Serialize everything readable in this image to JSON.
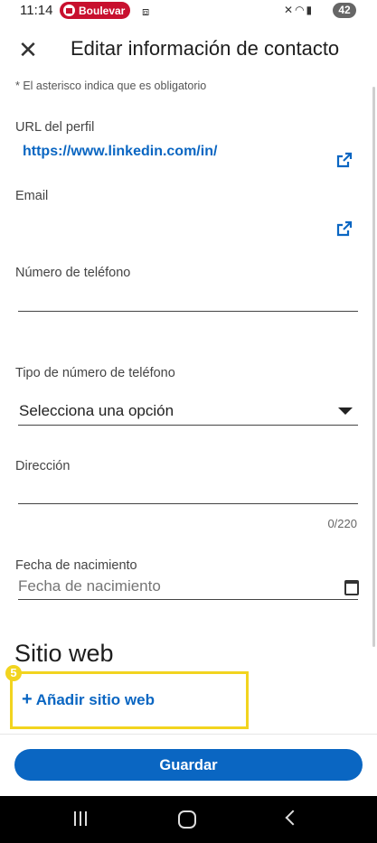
{
  "status_bar": {
    "time": "11:14",
    "media_label": "Boulevar",
    "battery": "42"
  },
  "header": {
    "title": "Editar información de contacto"
  },
  "form": {
    "required_hint": "* El asterisco indica que es obligatorio",
    "profile_url": {
      "label": "URL del perfil",
      "value": "https://www.linkedin.com/in/"
    },
    "email": {
      "label": "Email"
    },
    "phone": {
      "label": "Número de teléfono",
      "value": ""
    },
    "phone_type": {
      "label": "Tipo de número de teléfono",
      "selected": "Selecciona una opción"
    },
    "address": {
      "label": "Dirección",
      "value": "",
      "counter": "0/220"
    },
    "birthday": {
      "label": "Fecha de nacimiento",
      "placeholder": "Fecha de nacimiento"
    }
  },
  "website_section": {
    "title": "Sitio web",
    "add_label": "Añadir sitio web",
    "step_number": "5"
  },
  "footer": {
    "save_label": "Guardar"
  },
  "colors": {
    "accent": "#0a66c2",
    "highlight": "#f2d41f"
  }
}
